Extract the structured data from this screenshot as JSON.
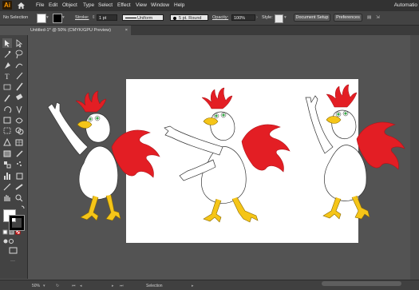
{
  "app": {
    "logo_text": "Ai",
    "menu": [
      "File",
      "Edit",
      "Object",
      "Type",
      "Select",
      "Effect",
      "View",
      "Window",
      "Help"
    ],
    "workspace_label": "Automatio"
  },
  "control_bar": {
    "selection_label": "No Selection",
    "stroke_label": "Stroke:",
    "stroke_value": "1 pt",
    "profile_value": "Uniform",
    "brush_value": "5 pt. Round",
    "opacity_label": "Opacity:",
    "opacity_value": "100%",
    "style_label": "Style:",
    "document_setup_label": "Document Setup",
    "preferences_label": "Preferences"
  },
  "document_tab": {
    "title": "Untitled-1* @ 50% (CMYK/GPU Preview)",
    "close": "×"
  },
  "status_bar": {
    "zoom": "50%",
    "tool": "Selection"
  },
  "colors": {
    "accent": "#ff9a00",
    "canvas": "#535353",
    "chrome": "#323232",
    "comb": "#e31e24",
    "beak": "#f5c518",
    "eye": "#3aa84a"
  },
  "icons": [
    "home-icon",
    "selection-tool-icon",
    "direct-selection-icon",
    "magic-wand-icon",
    "lasso-icon",
    "pen-icon",
    "type-icon",
    "line-icon",
    "rectangle-icon",
    "paintbrush-icon",
    "pencil-icon",
    "eraser-icon",
    "rotate-icon",
    "scale-icon",
    "width-icon",
    "free-transform-icon",
    "shape-builder-icon",
    "perspective-icon",
    "mesh-icon",
    "gradient-icon",
    "eyedropper-icon",
    "blend-icon",
    "symbol-sprayer-icon",
    "graph-icon",
    "artboard-icon",
    "slice-icon",
    "hand-icon",
    "zoom-icon"
  ]
}
